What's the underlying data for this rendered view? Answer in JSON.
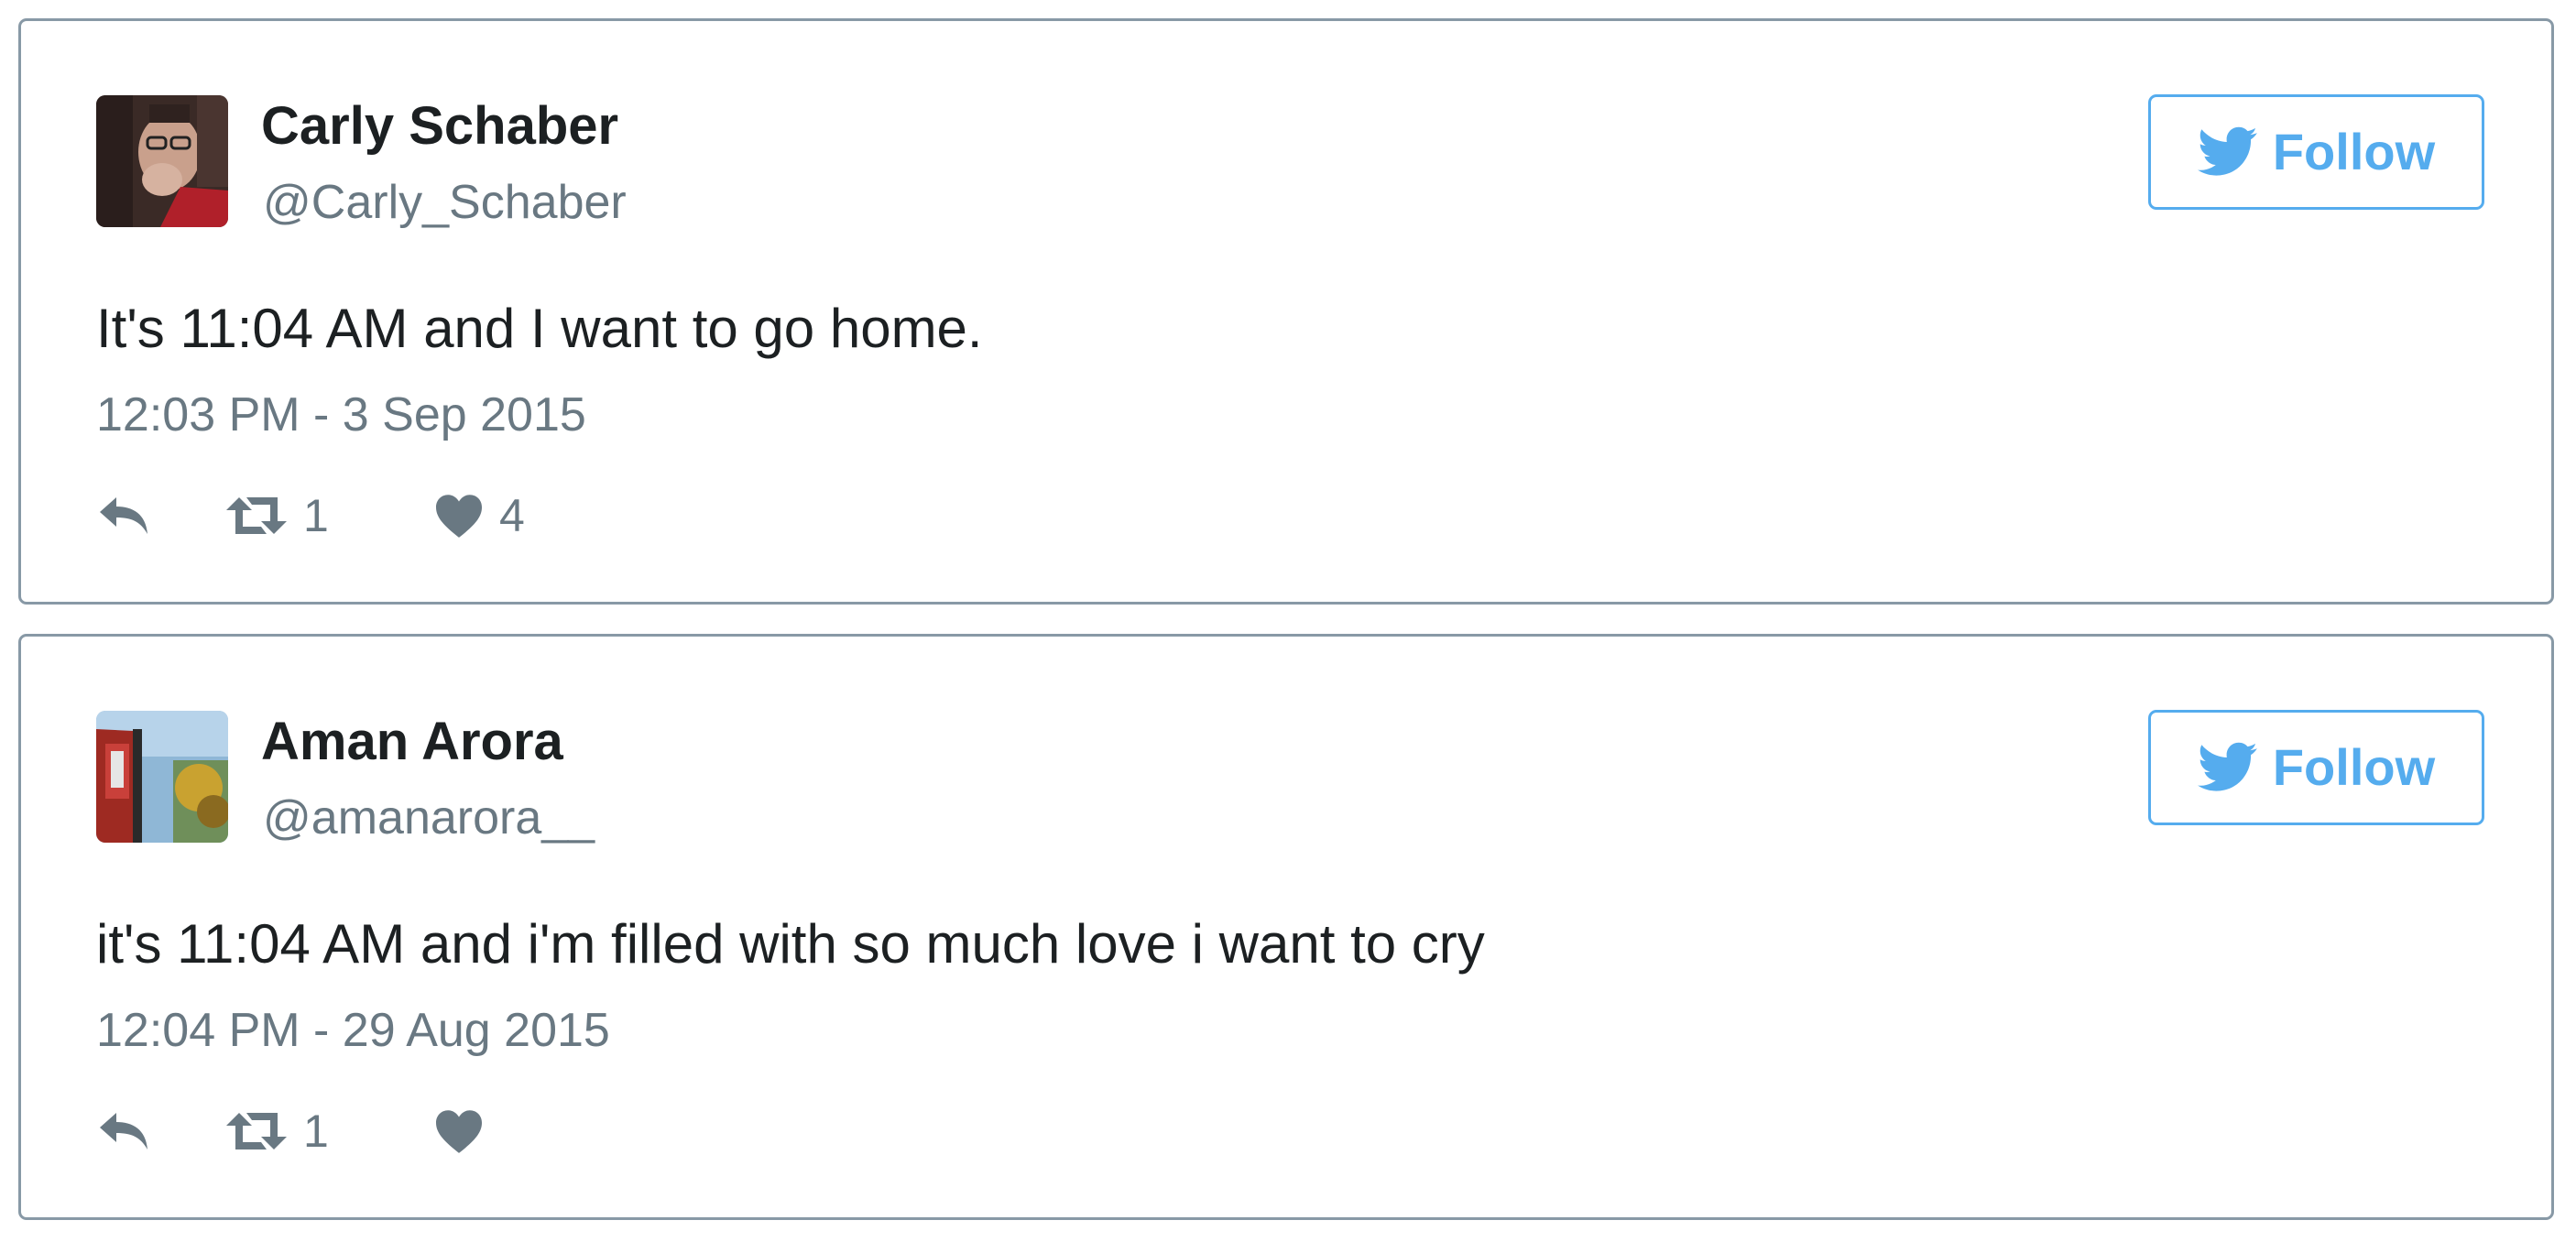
{
  "tweets": [
    {
      "display_name": "Carly Schaber",
      "screen_name": "@Carly_Schaber",
      "text": "It's 11:04 AM and I want to go home.",
      "timestamp": "12:03 PM - 3 Sep 2015",
      "follow_label": "Follow",
      "retweet_count": "1",
      "like_count": "4",
      "avatar_colors": [
        "#3a2a26",
        "#c9a08c",
        "#b0202a"
      ]
    },
    {
      "display_name": "Aman Arora",
      "screen_name": "@amanarora__",
      "text": "it's 11:04 AM and i'm filled with so much love i want to cry",
      "timestamp": "12:04 PM - 29 Aug 2015",
      "follow_label": "Follow",
      "retweet_count": "1",
      "like_count": "",
      "avatar_colors": [
        "#8fb7d6",
        "#9e2a22",
        "#c9a230"
      ]
    }
  ],
  "colors": {
    "accent": "#55acee",
    "text_primary": "#1c2022",
    "text_secondary": "#697882",
    "card_border": "#8899a6"
  },
  "icons": {
    "follow": "twitter-bird-icon",
    "reply": "reply-icon",
    "retweet": "retweet-icon",
    "like": "heart-icon"
  }
}
